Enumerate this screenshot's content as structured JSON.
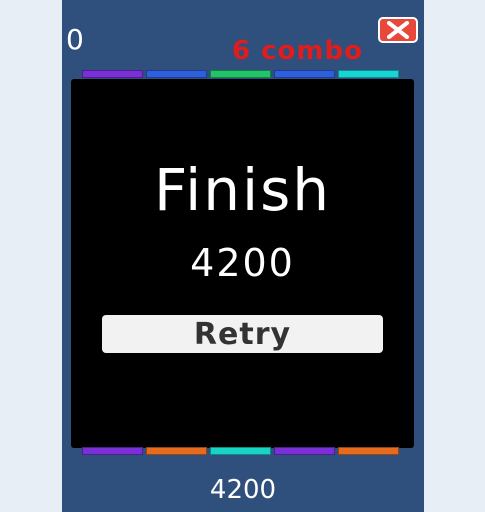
{
  "hud": {
    "score": "0",
    "combo": "6 combo",
    "combo_color": "#e01c1c",
    "close_icon": "close-x-icon",
    "close_color": "#e8483c"
  },
  "result": {
    "title": "Finish",
    "score": "4200",
    "retry_label": "Retry"
  },
  "footer": {
    "score": "4200"
  },
  "blocks": {
    "top_colors": [
      "#7b2fd6",
      "#2f5fdc",
      "#22c46a",
      "#2f5fdc",
      "#18d4d4"
    ],
    "bottom_colors": [
      "#7b2fd6",
      "#e86a1c",
      "#18d4c4",
      "#7b2fd6",
      "#e86a1c"
    ]
  },
  "colors": {
    "board": "#2f4f7c",
    "overlay": "#000000",
    "retry_button": "#f2f2f2"
  }
}
